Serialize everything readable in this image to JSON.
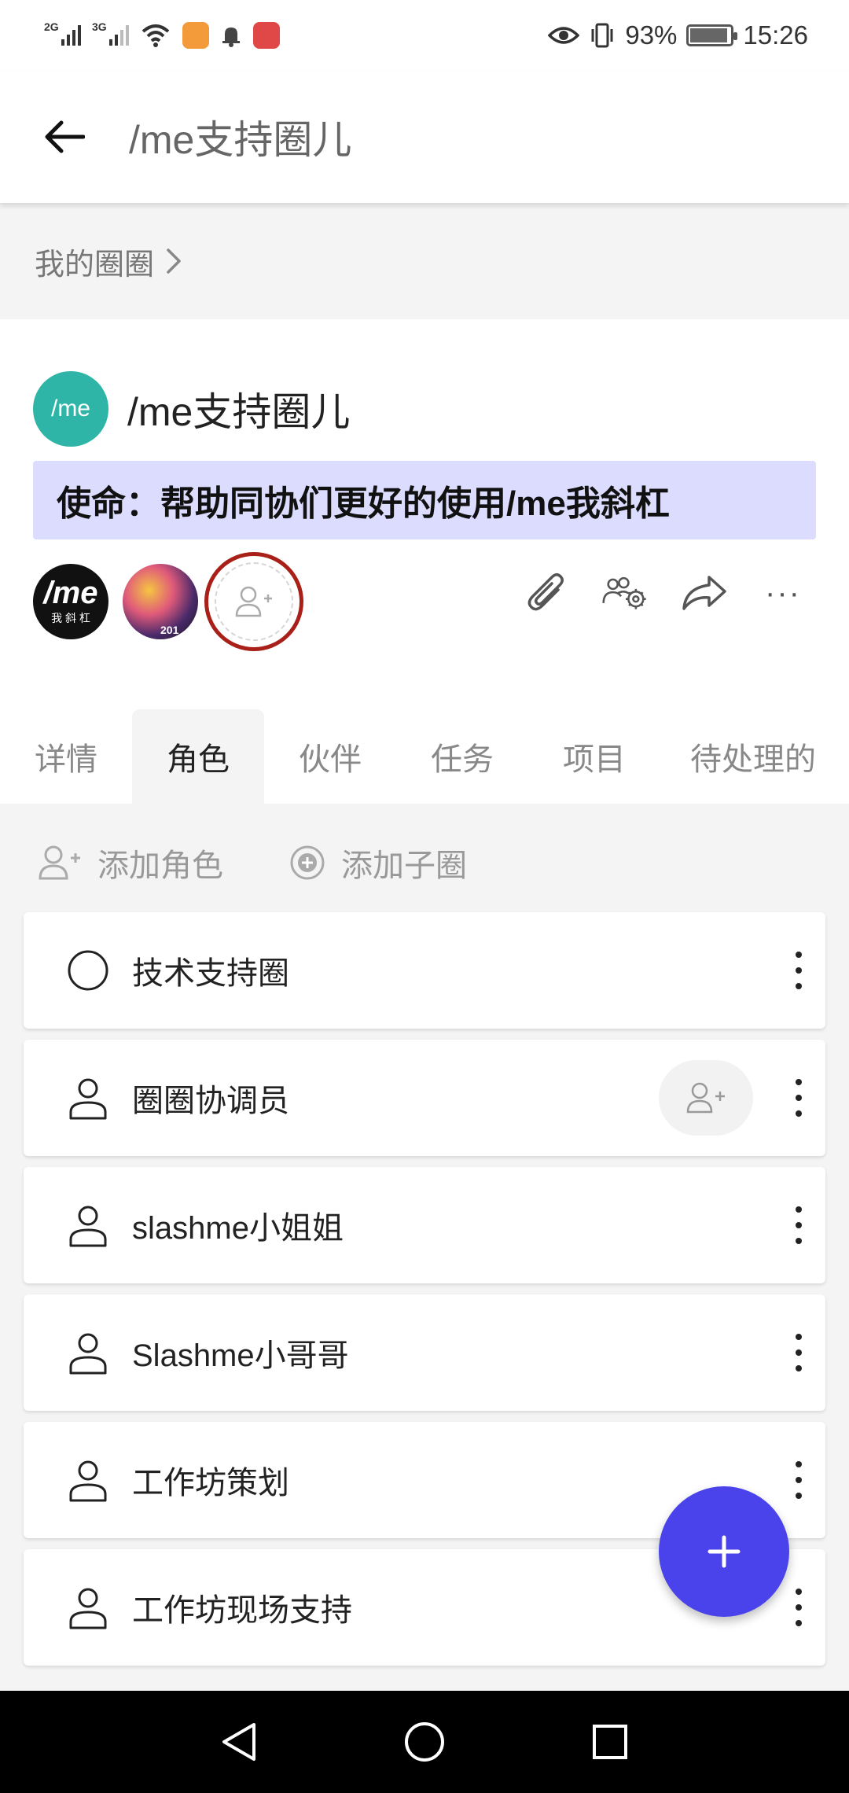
{
  "status_bar": {
    "net1": "2G",
    "net2": "3G",
    "battery_text": "93%",
    "time": "15:26"
  },
  "app_bar": {
    "title": "/me支持圈儿"
  },
  "breadcrumb": {
    "label": "我的圈圈"
  },
  "circle": {
    "logo_text": "/me",
    "name": "/me支持圈儿",
    "mission": "使命：帮助同协们更好的使用/me我斜杠",
    "avatar1_main": "/me",
    "avatar1_sub": "我 斜 杠",
    "avatar2_text": "201"
  },
  "tabs": [
    "详情",
    "角色",
    "伙伴",
    "任务",
    "项目",
    "待处理的"
  ],
  "active_tab": "角色",
  "add_actions": {
    "add_role": "添加角色",
    "add_subcircle": "添加子圈"
  },
  "roles": [
    {
      "label": "技术支持圈",
      "icon": "circle-icon"
    },
    {
      "label": "圈圈协调员",
      "icon": "person-icon"
    },
    {
      "label": "slashme小姐姐",
      "icon": "person-icon"
    },
    {
      "label": "Slashme小哥哥",
      "icon": "person-icon"
    },
    {
      "label": "工作坊策划",
      "icon": "person-icon"
    },
    {
      "label": "工作坊现场支持",
      "icon": "person-icon"
    }
  ],
  "colors": {
    "accent": "#4a42ea",
    "circle_logo": "#2eb5a7",
    "mission_bg": "#dcdcff",
    "highlight_ring": "#a82018"
  }
}
